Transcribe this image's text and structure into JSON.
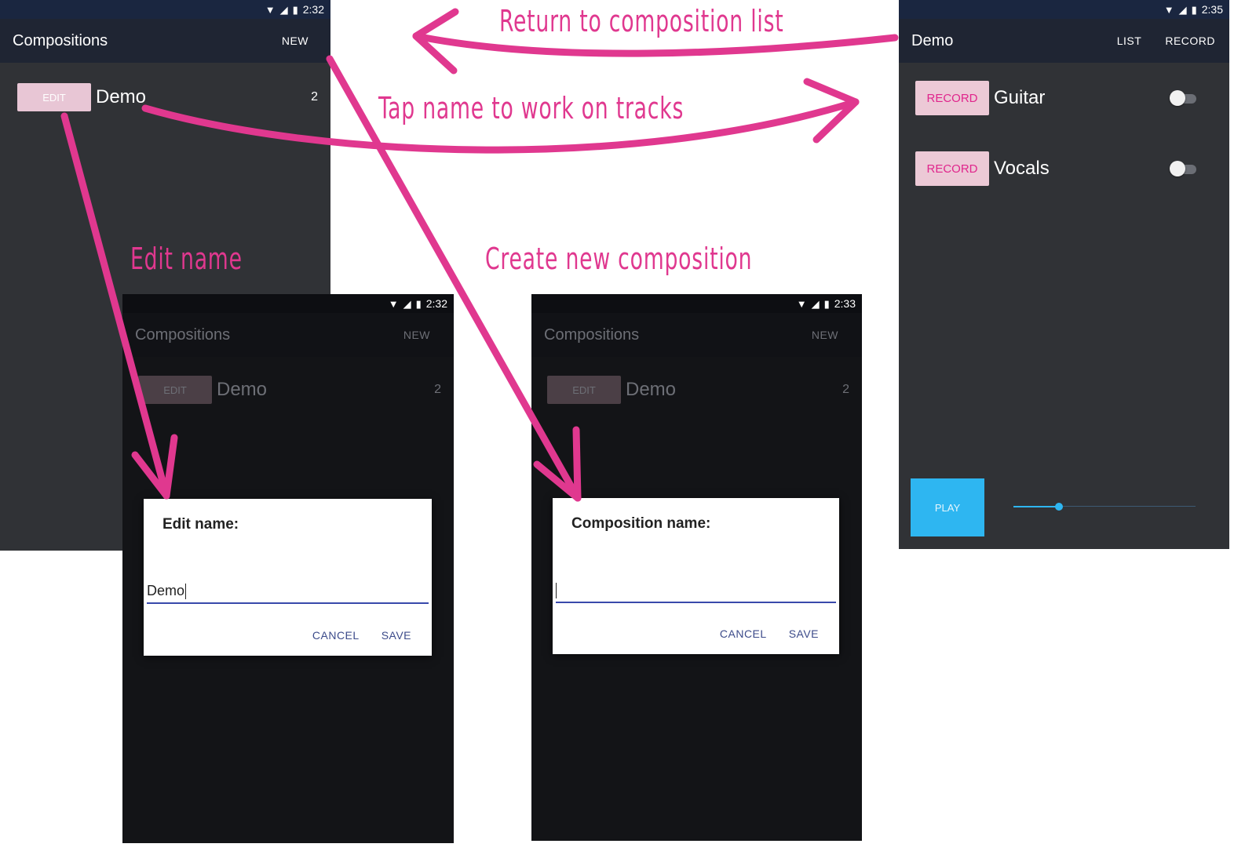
{
  "screen_list": {
    "status_time": "2:32",
    "title": "Compositions",
    "new_label": "NEW",
    "item": {
      "edit_label": "EDIT",
      "name": "Demo",
      "count": "2"
    }
  },
  "screen_tracks": {
    "status_time": "2:35",
    "title": "Demo",
    "list_label": "LIST",
    "record_label": "RECORD",
    "tracks": [
      {
        "button": "RECORD",
        "name": "Guitar"
      },
      {
        "button": "RECORD",
        "name": "Vocals"
      }
    ],
    "play_label": "PLAY",
    "seek_value": 0.25
  },
  "screen_edit": {
    "status_time": "2:32",
    "title": "Compositions",
    "new_label": "NEW",
    "item": {
      "edit_label": "EDIT",
      "name": "Demo",
      "count": "2"
    },
    "dialog": {
      "title": "Edit name:",
      "value": "Demo",
      "cancel": "CANCEL",
      "save": "SAVE"
    }
  },
  "screen_new": {
    "status_time": "2:33",
    "title": "Compositions",
    "new_label": "NEW",
    "item": {
      "edit_label": "EDIT",
      "name": "Demo",
      "count": "2"
    },
    "dialog": {
      "title": "Composition name:",
      "value": "",
      "cancel": "CANCEL",
      "save": "SAVE"
    }
  },
  "annotations": {
    "return": "Return to composition list",
    "tap": "Tap name to work on tracks",
    "edit": "Edit name",
    "create": "Create new composition"
  },
  "colors": {
    "accent_pink": "#e0388f",
    "appbar_bg": "#1f2533",
    "screen_bg": "#303236",
    "dim_bg": "#131417",
    "play_blue": "#2eb6f1",
    "record_text": "#e0258c"
  }
}
